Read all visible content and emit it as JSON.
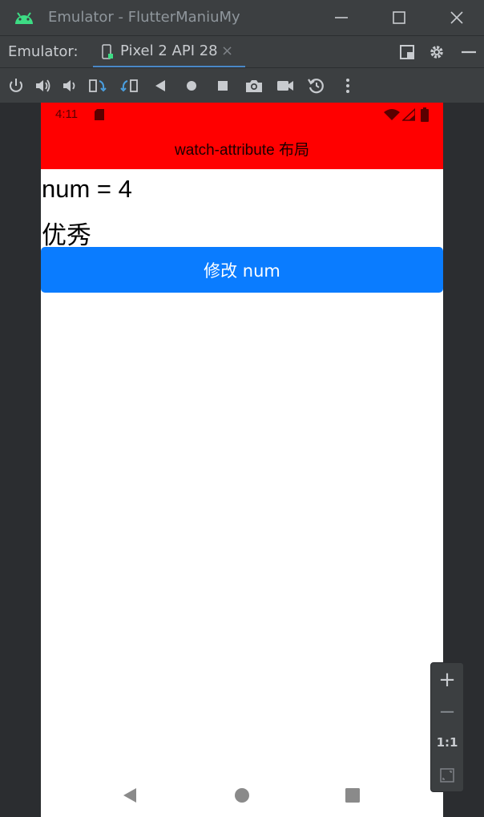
{
  "window": {
    "title": "Emulator - FlutterManiuMy"
  },
  "tabbar": {
    "label": "Emulator:",
    "tab_name": "Pixel 2 API 28",
    "close_glyph": "×"
  },
  "device": {
    "status_time": "4:11",
    "app_title": "watch-attribute 布局",
    "num_text": "num = 4",
    "grade_text": "优秀",
    "button_label": "修改 num",
    "accent": "#ff0000",
    "button_color": "#0a7cff"
  },
  "zoom": {
    "plus": "+",
    "minus": "−",
    "one_to_one": "1:1"
  }
}
